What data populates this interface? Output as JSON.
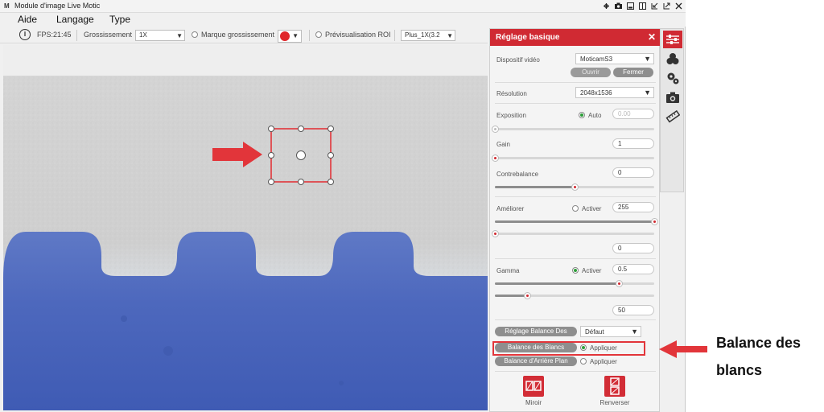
{
  "window": {
    "title": "Module d'image Live Motic",
    "controls": [
      "pin-icon",
      "camera-icon",
      "monitor-icon",
      "split-icon",
      "restore-down-icon",
      "maximize-icon",
      "close-icon"
    ]
  },
  "menu": {
    "items": [
      "Aide",
      "Langage",
      "Type"
    ]
  },
  "toolbar": {
    "fps": "FPS:21:45",
    "magnification_label": "Grossissement",
    "magnification_value": "1X",
    "mark_magnification_label": "Marque grossissement",
    "mark_color": "#e0262a",
    "roi_preview_label": "Prévisualisation ROI",
    "plus_value": "Plus_1X(3.2"
  },
  "panel": {
    "title": "Réglage basique",
    "video_device_label": "Dispositif vidéo",
    "video_device_value": "MoticamS3",
    "open_button": "Ouvrir",
    "close_button": "Fermer",
    "resolution_label": "Résolution",
    "resolution_value": "2048x1536",
    "exposure_label": "Exposition",
    "exposure_auto_label": "Auto",
    "exposure_value": "0.00",
    "exposure_slider": 0.0,
    "gain_label": "Gain",
    "gain_value": "1",
    "gain_slider": 0.0,
    "contrast_label": "Contrebalance",
    "contrast_value": "0",
    "contrast_slider": 0.5,
    "improve_label": "Améliorer",
    "improve_activate_label": "Activer",
    "improve_value": "255",
    "improve_slider_1": 1.0,
    "improve_slider_2": 0.0,
    "improve_value_2": "0",
    "gamma_label": "Gamma",
    "gamma_activate_label": "Activer",
    "gamma_value": "0.5",
    "gamma_slider_1": 0.78,
    "gamma_slider_2": 0.2,
    "gamma_value_2": "50",
    "wb_setting_button": "Réglage Balance Des",
    "wb_setting_value": "Défaut",
    "white_balance_button": "Balance des Blancs",
    "white_balance_apply": "Appliquer",
    "background_balance_button": "Balance d'Arrière Plan",
    "background_balance_apply": "Appliquer",
    "mirror_label": "Miroir",
    "flip_label": "Renverser"
  },
  "sidetabs": [
    "sliders-icon",
    "color-circles-icon",
    "gears-icon",
    "camera-icon",
    "ruler-icon"
  ],
  "annotation": {
    "line1": "Balance des",
    "line2": "blancs",
    "color": "#e2353a"
  }
}
